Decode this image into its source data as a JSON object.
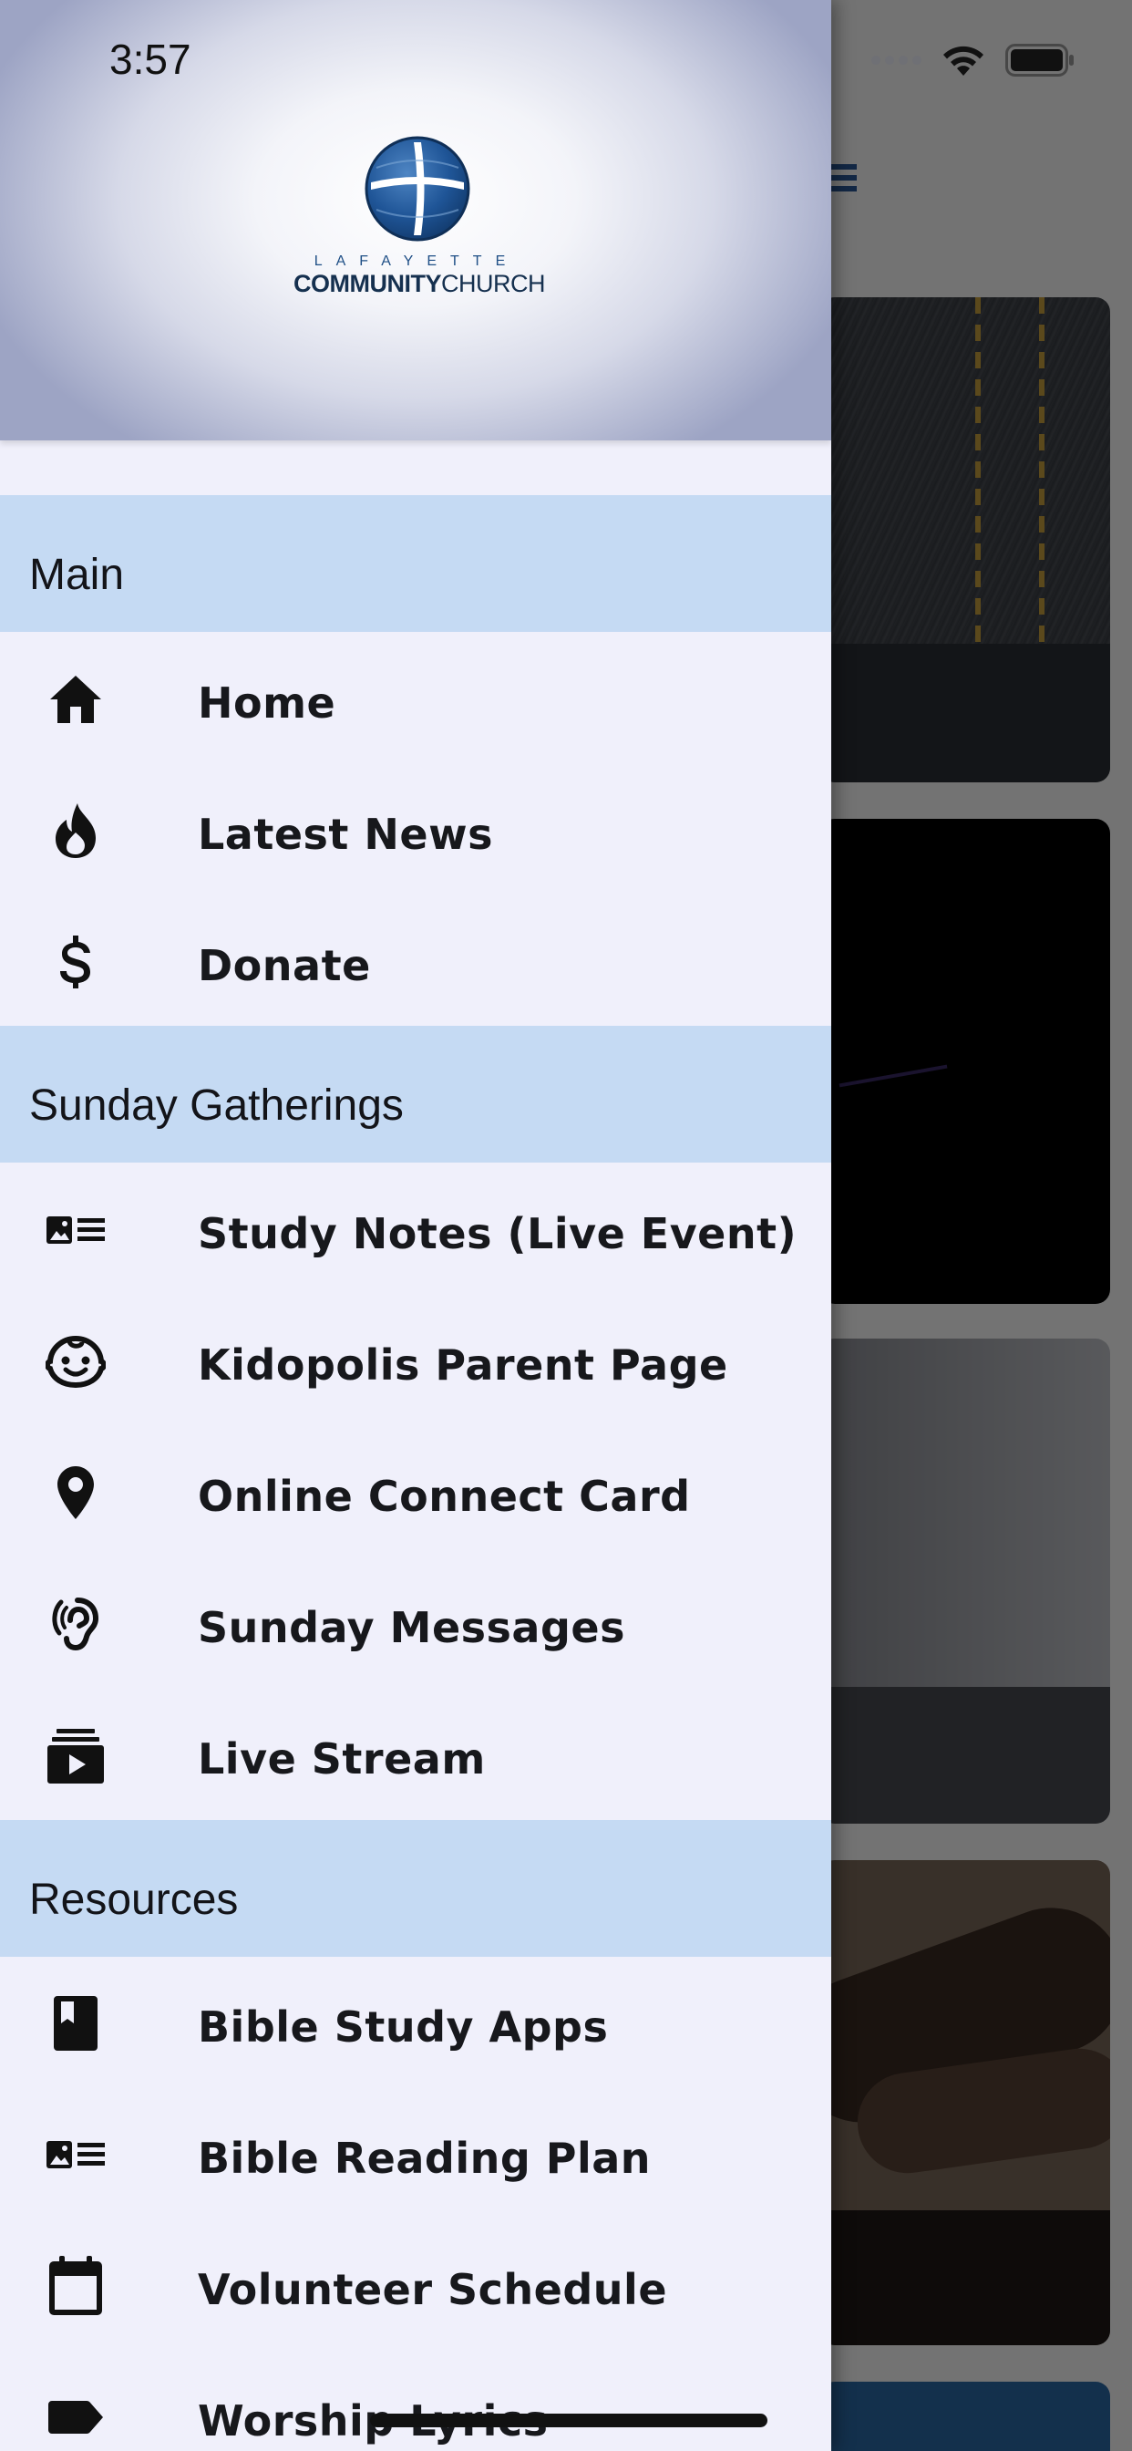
{
  "status_bar": {
    "time": "3:57"
  },
  "drawer": {
    "header": {
      "logo_subtitle": "LAFAYETTE",
      "logo_title_bold": "COMMUNITY",
      "logo_title_light": "CHURCH"
    },
    "sections": [
      {
        "label": "Main",
        "items": [
          {
            "label": "Home",
            "icon": "home-icon"
          },
          {
            "label": "Latest News",
            "icon": "fire-icon"
          },
          {
            "label": "Donate",
            "icon": "dollar-icon"
          }
        ]
      },
      {
        "label": "Sunday Gatherings",
        "items": [
          {
            "label": "Study Notes (Live Event)",
            "icon": "notes-card-icon"
          },
          {
            "label": "Kidopolis Parent Page",
            "icon": "child-face-icon"
          },
          {
            "label": "Online Connect Card",
            "icon": "map-pin-icon"
          },
          {
            "label": "Sunday Messages",
            "icon": "hearing-icon"
          },
          {
            "label": "Live Stream",
            "icon": "video-stack-icon"
          }
        ]
      },
      {
        "label": "Resources",
        "items": [
          {
            "label": "Bible Study Apps",
            "icon": "book-icon"
          },
          {
            "label": "Bible Reading Plan",
            "icon": "notes-card-icon"
          },
          {
            "label": "Volunteer Schedule",
            "icon": "calendar-icon"
          },
          {
            "label": "Worship Lyrics",
            "icon": "tag-icon"
          }
        ]
      }
    ]
  },
  "colors": {
    "drawer_background": "#f0f0fb",
    "section_header_background": "#c5daf3",
    "logo_blue": "#1f4f86"
  }
}
